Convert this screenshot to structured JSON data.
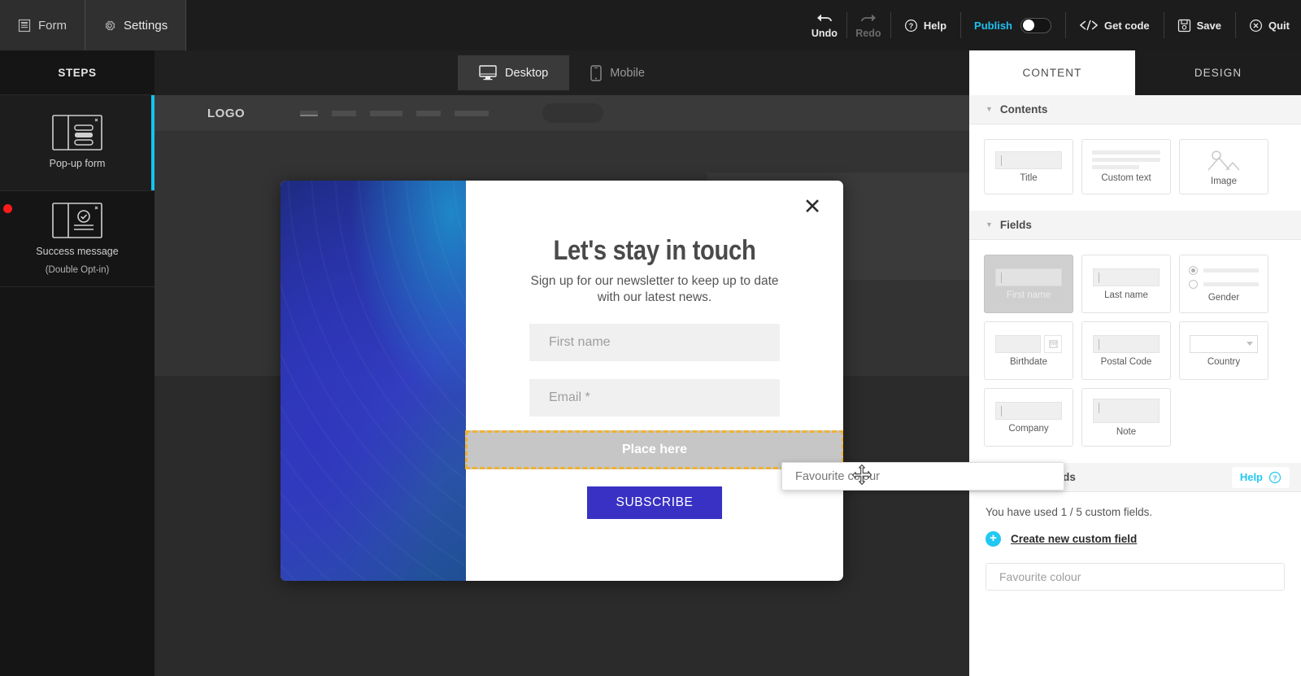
{
  "topbar": {
    "tabs": [
      {
        "label": "Form",
        "icon": "form-icon",
        "active": false
      },
      {
        "label": "Settings",
        "icon": "gear-icon",
        "active": true
      }
    ],
    "undo_label": "Undo",
    "redo_label": "Redo",
    "help_label": "Help",
    "publish_label": "Publish",
    "publish_on": false,
    "getcode_label": "Get code",
    "save_label": "Save",
    "quit_label": "Quit",
    "accent_color": "#1fc0f1"
  },
  "devicebar": {
    "desktop_label": "Desktop",
    "mobile_label": "Mobile",
    "selected": "Desktop"
  },
  "sidebar": {
    "title": "STEPS",
    "steps": [
      {
        "label": "Pop-up form",
        "sub": "",
        "active": true,
        "badge": false
      },
      {
        "label": "Success message",
        "sub": "(Double Opt-in)",
        "active": false,
        "badge": true
      }
    ],
    "active_color": "#16c4ee",
    "badge_color": "#fb1b1b"
  },
  "canvas": {
    "site": {
      "logo": "LOGO"
    }
  },
  "modal": {
    "title": "Let's stay in touch",
    "subtitle": "Sign up for our newsletter to keep up to date with our latest news.",
    "fields": [
      {
        "placeholder": "First name"
      },
      {
        "placeholder": "Email *"
      }
    ],
    "dropzone_label": "Place here",
    "submit_label": "SUBSCRIBE",
    "close_label": "✕",
    "submit_color": "#3831c4",
    "dropzone_border_color": "#f0b232"
  },
  "drag_ghost": {
    "label": "Favourite colour"
  },
  "rightpanel": {
    "tabs": [
      {
        "label": "CONTENT",
        "active": true
      },
      {
        "label": "DESIGN",
        "active": false
      }
    ],
    "contents": {
      "title": "Contents",
      "items": [
        {
          "label": "Title",
          "icon": "title-block-icon"
        },
        {
          "label": "Custom text",
          "icon": "text-lines-icon"
        },
        {
          "label": "Image",
          "icon": "image-icon"
        }
      ]
    },
    "fields": {
      "title": "Fields",
      "items": [
        {
          "label": "First name",
          "icon": "text-input-icon",
          "disabled": true
        },
        {
          "label": "Last name",
          "icon": "text-input-icon",
          "disabled": false
        },
        {
          "label": "Gender",
          "icon": "radio-group-icon",
          "disabled": false
        },
        {
          "label": "Birthdate",
          "icon": "date-input-icon",
          "disabled": false
        },
        {
          "label": "Postal Code",
          "icon": "text-input-icon",
          "disabled": false
        },
        {
          "label": "Country",
          "icon": "select-input-icon",
          "disabled": false
        },
        {
          "label": "Company",
          "icon": "text-input-icon",
          "disabled": false
        },
        {
          "label": "Note",
          "icon": "textarea-icon",
          "disabled": false
        }
      ]
    },
    "custom_fields": {
      "title": "Custom Fields",
      "help_label": "Help",
      "usage_text": "You have used 1 / 5 custom fields.",
      "create_label": "Create new custom field",
      "items": [
        {
          "label": "Favourite colour"
        }
      ]
    }
  }
}
